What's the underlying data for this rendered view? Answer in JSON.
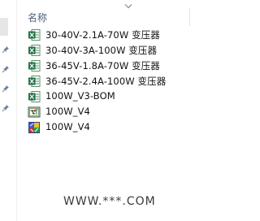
{
  "header": {
    "name_column": "名称"
  },
  "files": [
    {
      "name": "30-40V-2.1A-70W 变压器",
      "icon": "excel-file-icon"
    },
    {
      "name": "30-40V-3A-100W 变压器",
      "icon": "excel-file-icon"
    },
    {
      "name": "36-45V-1.8A-70W 变压器",
      "icon": "excel-file-icon"
    },
    {
      "name": "36-45V-2.4A-100W 变压器",
      "icon": "excel-file-icon"
    },
    {
      "name": "100W_V3-BOM",
      "icon": "excel-file-icon"
    },
    {
      "name": "100W_V4",
      "icon": "schematic-file-icon"
    },
    {
      "name": "100W_V4",
      "icon": "pcb-file-icon"
    }
  ],
  "watermark": "WWW.***.COM",
  "colors": {
    "excel_green": "#1f7244",
    "header_text": "#4c607a",
    "pin_blue": "#6b7f99"
  }
}
